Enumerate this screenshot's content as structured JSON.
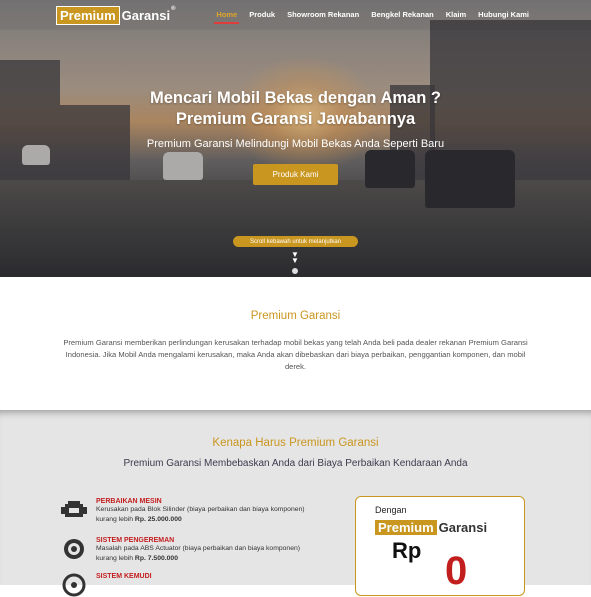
{
  "nav": {
    "logo_a": "Premium",
    "logo_b": "Garansi",
    "logo_tm": "®",
    "items": [
      "Home",
      "Produk",
      "Showroom Rekanan",
      "Bengkel Rekanan",
      "Klaim",
      "Hubungi Kami"
    ],
    "active": "Home"
  },
  "hero": {
    "title_line1": "Mencari Mobil Bekas dengan Aman ?",
    "title_line2": "Premium Garansi Jawabannya",
    "subtitle": "Premium Garansi Melindungi Mobil Bekas Anda Seperti Baru",
    "cta": "Produk Kami",
    "scroll_hint": "Scroll kebawah untuk melanjutkan"
  },
  "about": {
    "title": "Premium Garansi",
    "body": "Premium Garansi memberikan perlindungan kerusakan terhadap mobil bekas yang telah Anda beli pada dealer rekanan Premium Garansi Indonesia. Jika Mobil Anda mengalami kerusakan, maka Anda akan dibebaskan dari biaya perbaikan, penggantian komponen, dan mobil derek."
  },
  "why": {
    "title": "Kenapa Harus Premium Garansi",
    "subtitle": "Premium Garansi Membebaskan Anda dari Biaya Perbaikan Kendaraan Anda",
    "features": [
      {
        "icon": "engine-icon",
        "title": "PERBAIKAN MESIN",
        "desc": "Kerusakan pada Blok Silinder (biaya perbaikan dan biaya komponen) kurang lebih ",
        "amount": "Rp. 25.000.000"
      },
      {
        "icon": "brake-disc-icon",
        "title": "SISTEM PENGEREMAN",
        "desc": "Masalah pada ABS Actuator (biaya perbaikan dan biaya komponen) kurang lebih ",
        "amount": "Rp. 7.500.000"
      },
      {
        "icon": "steering-wheel-icon",
        "title": "SISTEM KEMUDI",
        "desc": "",
        "amount": ""
      }
    ],
    "card": {
      "prefix": "Dengan",
      "logo_a": "Premium",
      "logo_b": "Garansi",
      "currency": "Rp",
      "value": "0"
    }
  },
  "colors": {
    "accent": "#c9961f",
    "red": "#c21e1e",
    "active_nav": "#e0a52a"
  }
}
